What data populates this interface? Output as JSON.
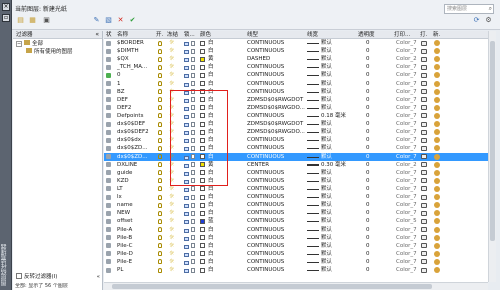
{
  "window": {
    "vertical_title": "图层特性管理器",
    "current_layer": "当前图层: 新建光纸",
    "search_placeholder": "搜索图层"
  },
  "tree": {
    "header": "过滤器",
    "nodes": [
      "全部",
      "所有使用的图层"
    ],
    "footer": "反转过滤器(I)"
  },
  "columns": {
    "status": "状",
    "name": "名称",
    "on": "开.",
    "freeze": "冻结",
    "lock": "锁...",
    "color": "颜色",
    "linetype": "线型",
    "lineweight": "线宽",
    "transparency": "透明度",
    "plotstyle": "打印...",
    "plot": "打.",
    "newvp": "新."
  },
  "rows": [
    {
      "name": "$BORDER",
      "color": "白",
      "swatch": "#ffffff",
      "linetype": "CONTINUOUS",
      "lw": "默认",
      "tp": "0",
      "ps": "Color_7"
    },
    {
      "name": "$DIMTH",
      "color": "白",
      "swatch": "#ffffff",
      "linetype": "CONTINUOUS",
      "lw": "默认",
      "tp": "0",
      "ps": "Color_7"
    },
    {
      "name": "$QX",
      "color": "黄",
      "swatch": "#f2e200",
      "linetype": "DASHED",
      "lw": "默认",
      "tp": "0",
      "ps": "Color_2"
    },
    {
      "name": "_TCH_MA...",
      "color": "白",
      "swatch": "#ffffff",
      "linetype": "CONTINUOUS",
      "lw": "默认",
      "tp": "0",
      "ps": "Color_7"
    },
    {
      "name": "0",
      "color": "白",
      "swatch": "#ffffff",
      "linetype": "CONTINUOUS",
      "lw": "默认",
      "tp": "0",
      "ps": "Color_7"
    },
    {
      "name": "1",
      "color": "白",
      "swatch": "#ffffff",
      "linetype": "CONTINUOUS",
      "lw": "默认",
      "tp": "0",
      "ps": "Color_7"
    },
    {
      "name": "BZ",
      "color": "白",
      "swatch": "#ffffff",
      "linetype": "CONTINUOUS",
      "lw": "默认",
      "tp": "0",
      "ps": "Color_7"
    },
    {
      "name": "DEF",
      "color": "白",
      "swatch": "#ffffff",
      "linetype": "ZDMSD$0$RWGDOT",
      "lw": "默认",
      "tp": "0",
      "ps": "Color_7"
    },
    {
      "name": "DEF2",
      "color": "白",
      "swatch": "#ffffff",
      "linetype": "ZDMSD$0$RWGDO...",
      "lw": "默认",
      "tp": "0",
      "ps": "Color_7"
    },
    {
      "name": "Defpoints",
      "color": "白",
      "swatch": "#ffffff",
      "linetype": "CONTINUOUS",
      "lw": "0.18 毫米",
      "tp": "0",
      "ps": "Color_7"
    },
    {
      "name": "dx$0$DEF",
      "color": "白",
      "swatch": "#ffffff",
      "linetype": "ZDMSD$0$RWGDOT",
      "lw": "默认",
      "tp": "0",
      "ps": "Color_7"
    },
    {
      "name": "dx$0$DEF2",
      "color": "白",
      "swatch": "#ffffff",
      "linetype": "ZDMSD$0$RWGDO...",
      "lw": "默认",
      "tp": "0",
      "ps": "Color_7"
    },
    {
      "name": "dx$0$dx",
      "color": "白",
      "swatch": "#ffffff",
      "linetype": "CONTINUOUS",
      "lw": "默认",
      "tp": "0",
      "ps": "Color_7"
    },
    {
      "name": "dx$0$ZD...",
      "color": "白",
      "swatch": "#ffffff",
      "linetype": "CONTINUOUS",
      "lw": "默认",
      "tp": "0",
      "ps": "Color_7"
    },
    {
      "name": "dx$0$ZD...",
      "color": "白",
      "swatch": "#ffffff",
      "linetype": "CONTINUOUS",
      "lw": "默认",
      "tp": "0",
      "ps": "Color_7",
      "selected": true
    },
    {
      "name": "DXLINE",
      "color": "黄",
      "swatch": "#f2e200",
      "linetype": "CENTER",
      "lw": "0.30 毫米",
      "tp": "0",
      "ps": "Color_2",
      "thick": true
    },
    {
      "name": "guide",
      "color": "白",
      "swatch": "#ffffff",
      "linetype": "CONTINUOUS",
      "lw": "默认",
      "tp": "0",
      "ps": "Color_7"
    },
    {
      "name": "KZD",
      "color": "白",
      "swatch": "#ffffff",
      "linetype": "CONTINUOUS",
      "lw": "默认",
      "tp": "0",
      "ps": "Color_7"
    },
    {
      "name": "LT",
      "color": "白",
      "swatch": "#ffffff",
      "linetype": "CONTINUOUS",
      "lw": "默认",
      "tp": "0",
      "ps": "Color_7"
    },
    {
      "name": "lx",
      "color": "白",
      "swatch": "#ffffff",
      "linetype": "CONTINUOUS",
      "lw": "默认",
      "tp": "0",
      "ps": "Color_7"
    },
    {
      "name": "name",
      "color": "白",
      "swatch": "#ffffff",
      "linetype": "CONTINUOUS",
      "lw": "默认",
      "tp": "0",
      "ps": "Color_7"
    },
    {
      "name": "NEW",
      "color": "白",
      "swatch": "#ffffff",
      "linetype": "CONTINUOUS",
      "lw": "默认",
      "tp": "0",
      "ps": "Color_7"
    },
    {
      "name": "offset",
      "color": "蓝",
      "swatch": "#1f3fd9",
      "linetype": "CONTINUOUS",
      "lw": "默认",
      "tp": "0",
      "ps": "Color_5"
    },
    {
      "name": "Pile-A",
      "color": "白",
      "swatch": "#ffffff",
      "linetype": "CONTINUOUS",
      "lw": "默认",
      "tp": "0",
      "ps": "Color_7"
    },
    {
      "name": "Pile-B",
      "color": "白",
      "swatch": "#ffffff",
      "linetype": "CONTINUOUS",
      "lw": "默认",
      "tp": "0",
      "ps": "Color_7"
    },
    {
      "name": "Pile-C",
      "color": "白",
      "swatch": "#ffffff",
      "linetype": "CONTINUOUS",
      "lw": "默认",
      "tp": "0",
      "ps": "Color_7"
    },
    {
      "name": "Pile-D",
      "color": "白",
      "swatch": "#ffffff",
      "linetype": "CONTINUOUS",
      "lw": "默认",
      "tp": "0",
      "ps": "Color_7"
    },
    {
      "name": "Pile-E",
      "color": "白",
      "swatch": "#ffffff",
      "linetype": "CONTINUOUS",
      "lw": "默认",
      "tp": "0",
      "ps": "Color_7"
    },
    {
      "name": "PL",
      "color": "白",
      "swatch": "#ffffff",
      "linetype": "CONTINUOUS",
      "lw": "默认",
      "tp": "0",
      "ps": "Color_7"
    }
  ],
  "status": "全部: 显示了 56 个图层"
}
